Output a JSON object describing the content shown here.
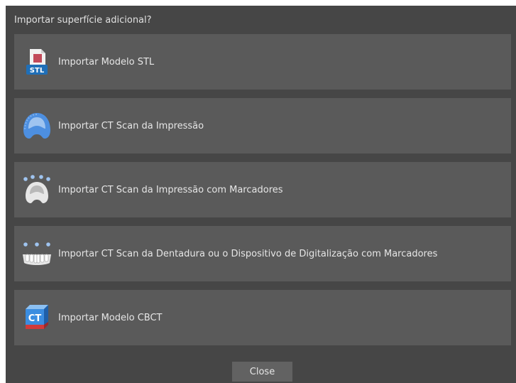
{
  "dialog": {
    "title": "Importar superfície adicional?",
    "close_label": "Close"
  },
  "options": [
    {
      "label": "Importar Modelo STL",
      "icon": "stl-file-icon",
      "icon_text": "STL"
    },
    {
      "label": "Importar CT Scan da Impressão",
      "icon": "impression-tray-icon"
    },
    {
      "label": "Importar CT Scan da Impressão com Marcadores",
      "icon": "impression-markers-icon"
    },
    {
      "label": "Importar CT Scan da Dentadura ou o Dispositivo de Digitalização com Marcadores",
      "icon": "denture-markers-icon"
    },
    {
      "label": "Importar Modelo CBCT",
      "icon": "ct-cube-icon",
      "icon_text": "CT"
    }
  ],
  "colors": {
    "dialog_bg": "#464646",
    "option_bg": "#5a5a5a",
    "text": "#e6e6e6",
    "icon_blue": "#2e86de"
  }
}
